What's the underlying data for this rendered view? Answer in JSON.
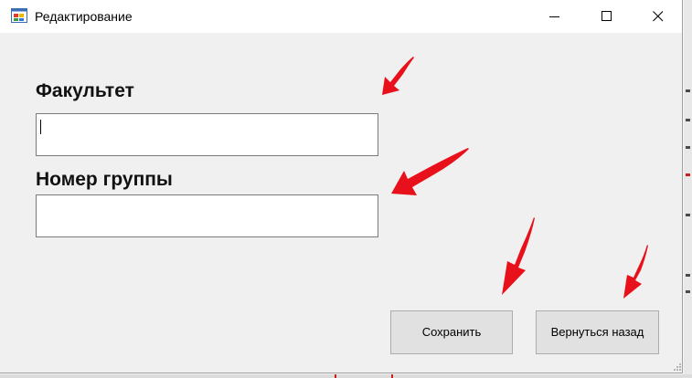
{
  "window": {
    "title": "Редактирование",
    "minimize_icon": "minimize-icon",
    "maximize_icon": "maximize-icon",
    "close_icon": "close-icon"
  },
  "form": {
    "faculty_label": "Факультет",
    "faculty_value": "",
    "group_label": "Номер группы",
    "group_value": ""
  },
  "buttons": {
    "save_label": "Сохранить",
    "back_label": "Вернуться назад"
  },
  "annotations": {
    "arrow_color": "#e8101a",
    "arrow_count": 4
  }
}
